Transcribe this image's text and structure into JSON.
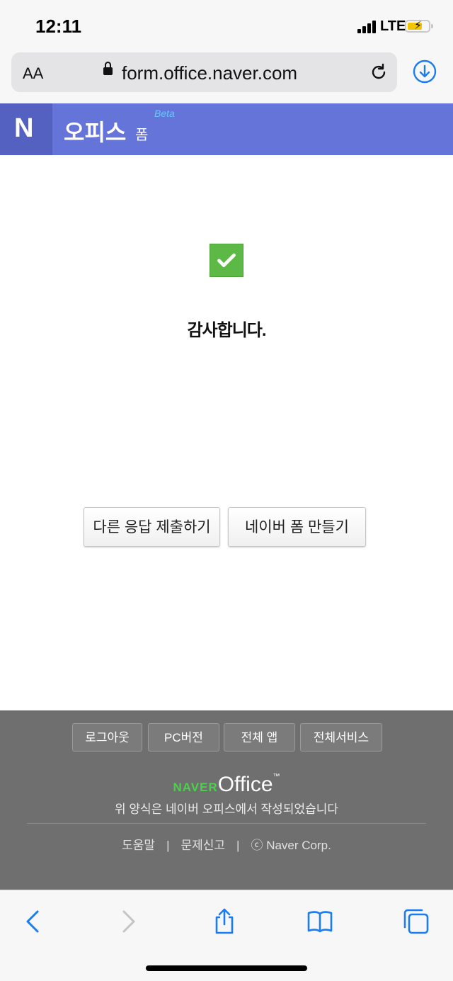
{
  "status_bar": {
    "time": "12:11",
    "carrier": "LTE",
    "battery_state": "charging"
  },
  "browser": {
    "text_size_label": "AA",
    "url": "form.office.naver.com",
    "icons": [
      "lock-icon",
      "reload-icon",
      "download-icon"
    ]
  },
  "header": {
    "logo_letter": "N",
    "title": "오피스",
    "subtitle": "폼",
    "badge": "Beta",
    "colors": {
      "bar": "#6474d9",
      "logo_bg": "#5561c1"
    }
  },
  "main": {
    "success_icon": "checkmark-icon",
    "success_color": "#5cb945",
    "heading": "감사합니다.",
    "buttons": {
      "submit_another": "다른 응답 제출하기",
      "create_form": "네이버 폼 만들기"
    }
  },
  "footer": {
    "buttons": {
      "logout": "로그아웃",
      "pc_version": "PC버전",
      "all_apps": "전체 앱",
      "all_services": "전체서비스"
    },
    "brand_naver": "NAVER",
    "brand_office": "Office",
    "brand_tm": "™",
    "description": "위 양식은 네이버 오피스에서 작성되었습니다",
    "links": {
      "help": "도움말",
      "report": "문제신고",
      "copyright": "ⓒ Naver Corp.",
      "separator": "|"
    },
    "colors": {
      "bg": "#6f6f6f",
      "brand_green": "#4bd14b"
    }
  },
  "toolbar": {
    "icons": [
      "back-icon",
      "forward-icon",
      "share-icon",
      "bookmarks-icon",
      "tabs-icon"
    ]
  }
}
